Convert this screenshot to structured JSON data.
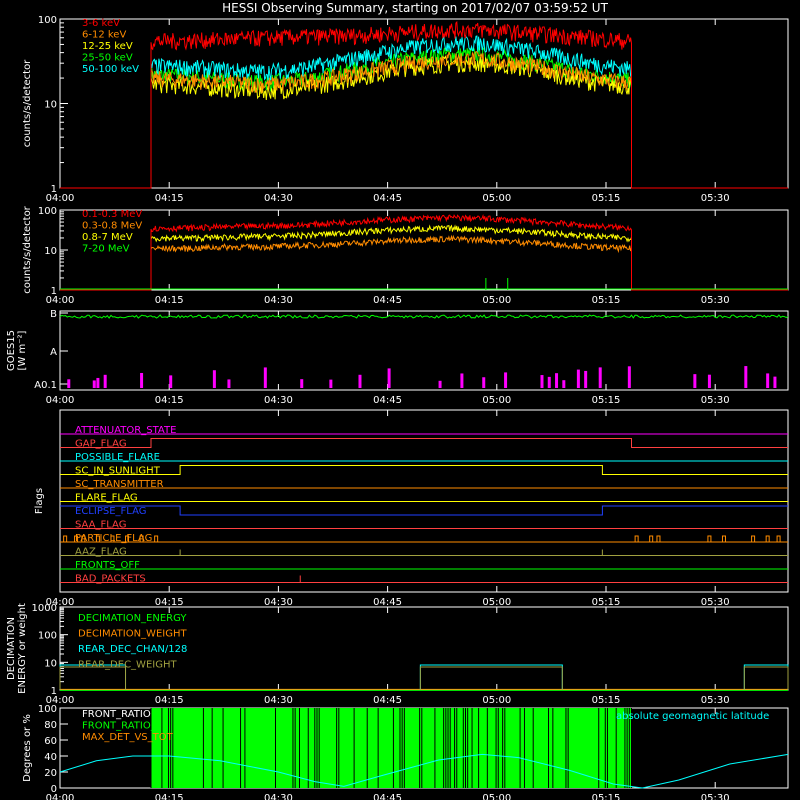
{
  "title": "HESSI Observing Summary, starting on 2017/02/07 03:59:52 UT",
  "time_axis": {
    "ticks": [
      "04:00",
      "04:15",
      "04:30",
      "04:45",
      "05:00",
      "05:15",
      "05:30"
    ],
    "range_minutes": [
      0,
      100
    ],
    "tick_minutes": [
      0,
      15,
      30,
      45,
      60,
      75,
      90
    ]
  },
  "chart_data": [
    {
      "type": "line",
      "name": "panel-low-energy",
      "ylabel": "counts/s/detector",
      "ylim": [
        1,
        100
      ],
      "log": true,
      "yticks": [
        "1",
        "10",
        "100"
      ],
      "data_window_minutes": [
        12.5,
        78.5
      ],
      "series": [
        {
          "name": "3-6 keV",
          "color": "#ff0000",
          "values": [
            55,
            56,
            58,
            60,
            62,
            63,
            66,
            70,
            75,
            75,
            70,
            65,
            60,
            55
          ]
        },
        {
          "name": "6-12 keV",
          "color": "#ff8c00",
          "values": [
            20,
            19,
            18,
            17,
            18,
            21,
            25,
            30,
            34,
            34,
            30,
            25,
            20,
            18
          ]
        },
        {
          "name": "12-25 keV",
          "color": "#ffff00",
          "values": [
            17,
            16,
            15,
            14,
            15,
            18,
            22,
            27,
            30,
            30,
            27,
            22,
            18,
            16
          ]
        },
        {
          "name": "25-50 keV",
          "color": "#00ff00",
          "values": [
            22,
            21,
            19,
            18,
            19,
            23,
            28,
            34,
            38,
            38,
            33,
            27,
            22,
            19
          ]
        },
        {
          "name": "50-100 keV",
          "color": "#00ffff",
          "values": [
            28,
            27,
            25,
            24,
            26,
            31,
            38,
            46,
            52,
            52,
            45,
            37,
            30,
            26
          ]
        }
      ],
      "x_minutes": [
        13,
        18,
        23,
        28,
        33,
        38,
        43,
        48,
        53,
        58,
        63,
        68,
        73,
        78
      ]
    },
    {
      "type": "line",
      "name": "panel-high-energy",
      "ylabel": "counts/s/detector",
      "ylim": [
        1,
        100
      ],
      "log": true,
      "yticks": [
        "1",
        "10",
        "100"
      ],
      "data_window_minutes": [
        12.5,
        78.5
      ],
      "series": [
        {
          "name": "0.1-0.3 MeV",
          "color": "#ff0000",
          "values": [
            35,
            36,
            38,
            40,
            42,
            48,
            55,
            60,
            65,
            62,
            55,
            48,
            40,
            36
          ]
        },
        {
          "name": "0.3-0.8 MeV",
          "color": "#ff8c00",
          "values": [
            11,
            11,
            12,
            12,
            13,
            14,
            16,
            18,
            19,
            18,
            16,
            14,
            12,
            11
          ]
        },
        {
          "name": "0.8-7 MeV",
          "color": "#ffff00",
          "values": [
            20,
            20,
            21,
            22,
            23,
            26,
            30,
            33,
            35,
            33,
            30,
            26,
            22,
            20
          ]
        },
        {
          "name": "7-20 MeV",
          "color": "#00ff00",
          "values": [
            1,
            1,
            1,
            1,
            1,
            1,
            1,
            1,
            1,
            1,
            1,
            1,
            1,
            1
          ]
        }
      ],
      "x_minutes": [
        13,
        18,
        23,
        28,
        33,
        38,
        43,
        48,
        53,
        58,
        63,
        68,
        73,
        78
      ]
    },
    {
      "type": "line",
      "name": "panel-goes",
      "ylabel_top": "GOES15",
      "ylabel_bottom": "[W m⁻²]",
      "yticks": [
        "A0.1",
        "A",
        "B"
      ],
      "goes_level": 0.93,
      "goes_color": "#00ff00",
      "event_color": "#ff00ff",
      "event_minutes": [
        1,
        4.5,
        5,
        6,
        11,
        15,
        21,
        23,
        28,
        33,
        37,
        41,
        45,
        52,
        55,
        58,
        61,
        66,
        67,
        68,
        69,
        71,
        72,
        74,
        78,
        87,
        89,
        94,
        97,
        98
      ]
    },
    {
      "type": "line",
      "name": "panel-flags",
      "ylabel": "Flags",
      "flags": [
        {
          "label": "ATTENUATOR_STATE",
          "color": "#ff00ff",
          "segments": []
        },
        {
          "label": "GAP_FLAG",
          "color": "#ff4040",
          "segments": [
            [
              0,
              0
            ],
            [
              12.5,
              1
            ],
            [
              78.5,
              0
            ],
            [
              100,
              0
            ]
          ]
        },
        {
          "label": "POSSIBLE_FLARE",
          "color": "#00ffff",
          "segments": []
        },
        {
          "label": "SC_IN_SUNLIGHT",
          "color": "#ffff00",
          "segments": [
            [
              0,
              0
            ],
            [
              16.5,
              1
            ],
            [
              74.5,
              0
            ],
            [
              100,
              0
            ]
          ]
        },
        {
          "label": "SC_TRANSMITTER",
          "color": "#ff8c00",
          "segments": []
        },
        {
          "label": "FLARE_FLAG",
          "color": "#ffff00",
          "segments": []
        },
        {
          "label": "ECLIPSE_FLAG",
          "color": "#2040ff",
          "segments": [
            [
              0,
              1
            ],
            [
              16.5,
              0
            ],
            [
              74.5,
              1
            ],
            [
              100,
              1
            ]
          ]
        },
        {
          "label": "SAA_FLAG",
          "color": "#ff4040",
          "segments": []
        },
        {
          "label": "PARTICLE_FLAG",
          "color": "#ff8c00",
          "segments": []
        },
        {
          "label": "AAZ_FLAG",
          "color": "#a0a040",
          "segments": []
        },
        {
          "label": "FRONTS_OFF",
          "color": "#00ff00",
          "segments": []
        },
        {
          "label": "BAD_PACKETS",
          "color": "#ff4040",
          "segments": []
        }
      ]
    },
    {
      "type": "line",
      "name": "panel-decimation",
      "ylabel_top": "DECIMATION",
      "ylabel_bottom": "ENERGY or weight",
      "ylim": [
        1,
        1000
      ],
      "log": true,
      "yticks": [
        "1",
        "10",
        "100",
        "1000"
      ],
      "series": [
        {
          "name": "DECIMATION_ENERGY",
          "color": "#00ff00"
        },
        {
          "name": "DECIMATION_WEIGHT",
          "color": "#ff8c00"
        },
        {
          "name": "REAR_DEC_CHAN/128",
          "color": "#00ffff"
        },
        {
          "name": "REAR_DEC_WEIGHT",
          "color": "#a0a040"
        }
      ],
      "rear_dec_windows_minutes": [
        [
          0,
          9
        ],
        [
          49.5,
          69
        ],
        [
          94,
          100
        ]
      ]
    },
    {
      "type": "line",
      "name": "panel-ratio",
      "ylabel": "Degrees or %",
      "ylim": [
        0,
        100
      ],
      "yticks": [
        "0",
        "20",
        "40",
        "60",
        "80",
        "100"
      ],
      "series": [
        {
          "name": "FRONT_RATIO",
          "color": "#ffffff"
        },
        {
          "name": "FRONT_RATIO_",
          "color": "#00ff00"
        },
        {
          "name": "MAX_DET_VS_TOT",
          "color": "#ff8c00"
        }
      ],
      "annotation": "absolute geomagnetic latitude",
      "annotation_color": "#00ffff",
      "front_window_minutes": [
        12.5,
        78.5
      ],
      "latitude": [
        [
          0,
          20
        ],
        [
          5,
          34
        ],
        [
          10,
          40
        ],
        [
          15,
          40
        ],
        [
          22,
          34
        ],
        [
          30,
          20
        ],
        [
          35,
          8
        ],
        [
          39,
          2
        ],
        [
          44,
          15
        ],
        [
          52,
          35
        ],
        [
          58,
          42
        ],
        [
          63,
          38
        ],
        [
          70,
          22
        ],
        [
          76,
          5
        ],
        [
          80,
          0
        ],
        [
          85,
          10
        ],
        [
          92,
          30
        ],
        [
          100,
          42
        ]
      ]
    }
  ]
}
